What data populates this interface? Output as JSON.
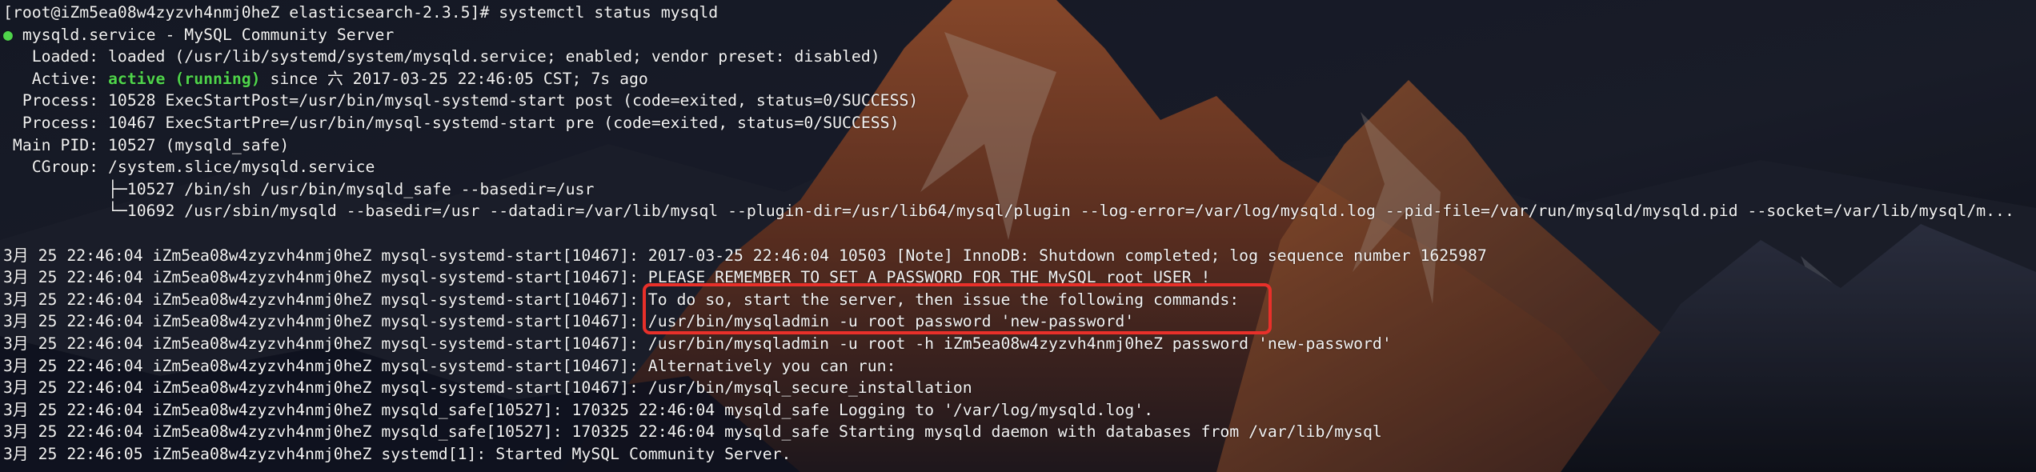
{
  "colors": {
    "text": "#f2f2f2",
    "active_status": "#4fd44b",
    "highlight_border": "#e8302a",
    "background": "#181c2a"
  },
  "terminal": {
    "prompt_line": "[root@iZm5ea08w4zyzvh4nmj0heZ elasticsearch-2.3.5]# systemctl status mysqld",
    "service_dot": "●",
    "service_title": " mysqld.service - MySQL Community Server",
    "loaded": "   Loaded: loaded (/usr/lib/systemd/system/mysqld.service; enabled; vendor preset: disabled)",
    "active_prefix": "   Active: ",
    "active_state": "active (running)",
    "active_suffix": " since 六 2017-03-25 22:46:05 CST; 7s ago",
    "process_1": "  Process: 10528 ExecStartPost=/usr/bin/mysql-systemd-start post (code=exited, status=0/SUCCESS)",
    "process_2": "  Process: 10467 ExecStartPre=/usr/bin/mysql-systemd-start pre (code=exited, status=0/SUCCESS)",
    "main_pid": " Main PID: 10527 (mysqld_safe)",
    "cgroup": "   CGroup: /system.slice/mysqld.service",
    "cgroup_child_1": "           ├─10527 /bin/sh /usr/bin/mysqld_safe --basedir=/usr",
    "cgroup_child_2": "           └─10692 /usr/sbin/mysqld --basedir=/usr --datadir=/var/lib/mysql --plugin-dir=/usr/lib64/mysql/plugin --log-error=/var/log/mysqld.log --pid-file=/var/run/mysqld/mysqld.pid --socket=/var/lib/mysql/m...",
    "log_lines": [
      "3月 25 22:46:04 iZm5ea08w4zyzvh4nmj0heZ mysql-systemd-start[10467]: 2017-03-25 22:46:04 10503 [Note] InnoDB: Shutdown completed; log sequence number 1625987",
      "3月 25 22:46:04 iZm5ea08w4zyzvh4nmj0heZ mysql-systemd-start[10467]: PLEASE REMEMBER TO SET A PASSWORD FOR THE MySQL root USER !",
      "3月 25 22:46:04 iZm5ea08w4zyzvh4nmj0heZ mysql-systemd-start[10467]: To do so, start the server, then issue the following commands:",
      "3月 25 22:46:04 iZm5ea08w4zyzvh4nmj0heZ mysql-systemd-start[10467]: /usr/bin/mysqladmin -u root password 'new-password'",
      "3月 25 22:46:04 iZm5ea08w4zyzvh4nmj0heZ mysql-systemd-start[10467]: /usr/bin/mysqladmin -u root -h iZm5ea08w4zyzvh4nmj0heZ password 'new-password'",
      "3月 25 22:46:04 iZm5ea08w4zyzvh4nmj0heZ mysql-systemd-start[10467]: Alternatively you can run:",
      "3月 25 22:46:04 iZm5ea08w4zyzvh4nmj0heZ mysql-systemd-start[10467]: /usr/bin/mysql_secure_installation",
      "3月 25 22:46:04 iZm5ea08w4zyzvh4nmj0heZ mysqld_safe[10527]: 170325 22:46:04 mysqld_safe Logging to '/var/log/mysqld.log'.",
      "3月 25 22:46:04 iZm5ea08w4zyzvh4nmj0heZ mysqld_safe[10527]: 170325 22:46:04 mysqld_safe Starting mysqld daemon with databases from /var/lib/mysql",
      "3月 25 22:46:05 iZm5ea08w4zyzvh4nmj0heZ systemd[1]: Started MySQL Community Server."
    ]
  }
}
